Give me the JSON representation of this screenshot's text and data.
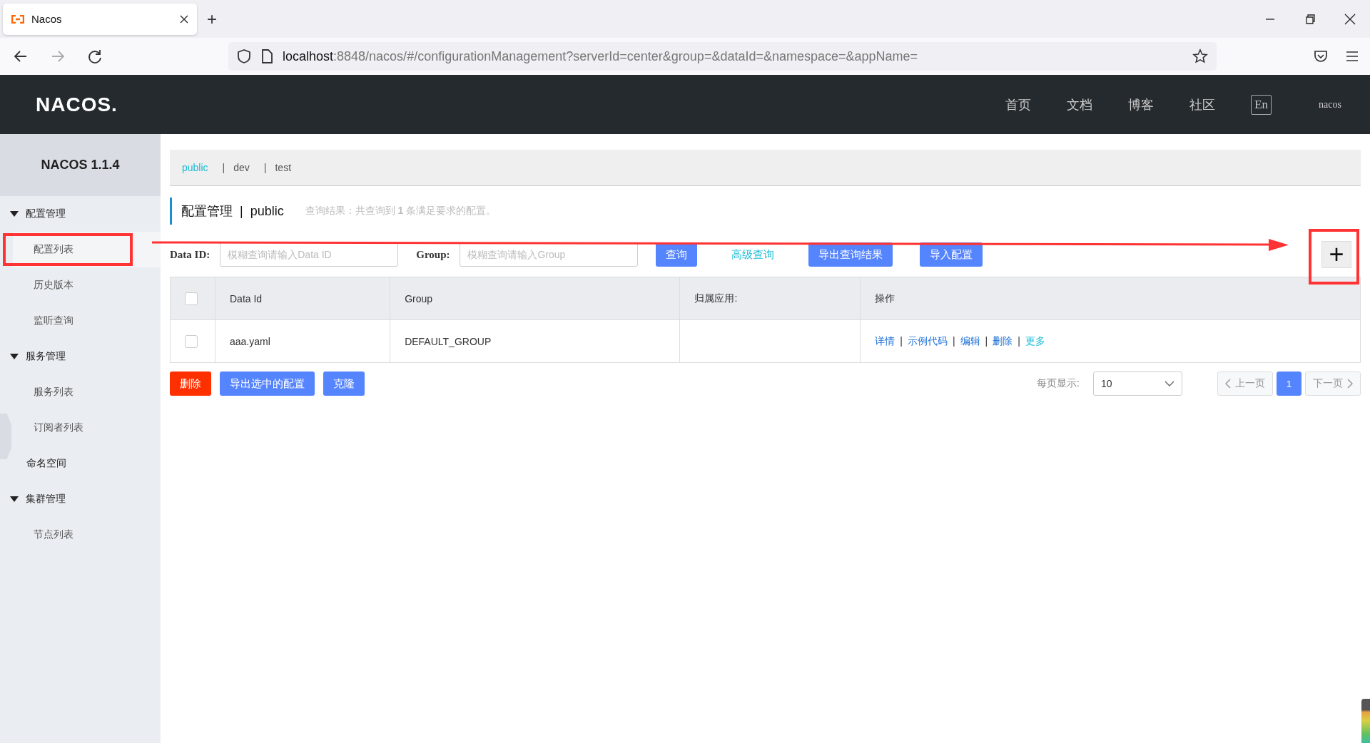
{
  "browser": {
    "tab": {
      "title": "Nacos"
    },
    "new_tab": "+",
    "url": {
      "host": "localhost",
      "rest": ":8848/nacos/#/configurationManagement?serverId=center&group=&dataId=&namespace=&appName="
    }
  },
  "header": {
    "logo": "NACOS.",
    "nav": [
      {
        "label": "首页"
      },
      {
        "label": "文档"
      },
      {
        "label": "博客"
      },
      {
        "label": "社区"
      }
    ],
    "lang": {
      "label": "En",
      "selected": true
    },
    "user": "nacos"
  },
  "sidebar": {
    "title": "NACOS 1.1.4",
    "items": [
      {
        "kind": "group",
        "label": "配置管理",
        "expanded": true,
        "children": [
          {
            "label": "配置列表",
            "selected": true
          },
          {
            "label": "历史版本",
            "selected": false
          },
          {
            "label": "监听查询",
            "selected": false
          }
        ]
      },
      {
        "kind": "group",
        "label": "服务管理",
        "expanded": true,
        "children": [
          {
            "label": "服务列表",
            "selected": false
          },
          {
            "label": "订阅者列表",
            "selected": false
          }
        ]
      },
      {
        "kind": "leaf",
        "label": "命名空间",
        "selected": false
      },
      {
        "kind": "group",
        "label": "集群管理",
        "expanded": true,
        "children": [
          {
            "label": "节点列表",
            "selected": false
          }
        ]
      }
    ]
  },
  "namespaces": {
    "separator": "|",
    "items": [
      {
        "label": "public",
        "selected": true
      },
      {
        "label": "dev",
        "selected": false
      },
      {
        "label": "test",
        "selected": false
      }
    ]
  },
  "page_title": {
    "title": "配置管理",
    "separator": "|",
    "namespace": "public",
    "result": "查询结果：共查询到 **1** 条满足要求的配置。"
  },
  "search": {
    "fields": [
      {
        "label": "Data ID:",
        "placeholder": "模糊查询请输入Data ID"
      },
      {
        "label": "Group:",
        "placeholder": "模糊查询请输入Group"
      }
    ],
    "buttons": [
      {
        "label": "查询",
        "kind": "primary"
      },
      {
        "label": "高级查询",
        "kind": "link"
      },
      {
        "label": "导出查询结果",
        "kind": "primary"
      },
      {
        "label": "导入配置",
        "kind": "primary"
      }
    ],
    "add_button": "+"
  },
  "table": {
    "header_checked": false,
    "columns": [
      "Data Id",
      "Group",
      "归属应用:",
      "操作"
    ],
    "action_separator": "|",
    "rows": [
      {
        "checked": false,
        "data_id": "aaa.yaml",
        "group": "DEFAULT_GROUP",
        "actions": [
          {
            "label": "详情",
            "kind": "link"
          },
          {
            "label": "示例代码",
            "kind": "link"
          },
          {
            "label": "编辑",
            "kind": "link"
          },
          {
            "label": "删除",
            "kind": "link"
          },
          {
            "label": "更多",
            "kind": "more"
          }
        ]
      }
    ]
  },
  "bulk_buttons": [
    {
      "label": "删除",
      "kind": "danger"
    },
    {
      "label": "导出选中的配置",
      "kind": "primary"
    },
    {
      "label": "克隆",
      "kind": "primary"
    }
  ],
  "pagination": {
    "page_size_label": "每页显示:",
    "page_size": "10",
    "prev": {
      "label": "上一页",
      "disabled": true
    },
    "pages": [
      {
        "label": "1",
        "selected": true
      }
    ],
    "next": {
      "label": "下一页",
      "disabled": true
    }
  }
}
